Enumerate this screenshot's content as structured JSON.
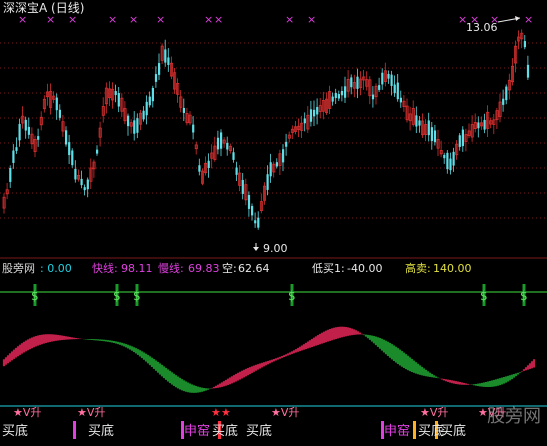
{
  "header": {
    "title": "深深宝A (日线)",
    "title_color": "#e8e8e8"
  },
  "price_panel": {
    "high_label": "13.06",
    "low_label": "9.00",
    "up_color": "#d93030",
    "down_color": "#5fe0e8",
    "signal_mark": "×",
    "signal_color": "#e040e0"
  },
  "indicators": {
    "name_label": "股旁网",
    "name_value": ": 0.00",
    "fast_label": "快线:",
    "fast_value": "98.11",
    "slow_label": "慢线:",
    "slow_value": "69.83",
    "kong_label": "空:",
    "kong_value": "62.64",
    "low_buy_label": "低买1:",
    "low_buy_value": "-40.00",
    "high_sell_label": "高卖:",
    "high_sell_value": "140.00",
    "colors": {
      "name": "#d8d8d8",
      "fast": "#e040e0",
      "slow": "#e040e0",
      "kong": "#e8e8e8",
      "low_buy": "#e8e8e8",
      "high_sell": "#e0e040"
    }
  },
  "signal_strip": {
    "line_color": "#40e040",
    "marker": "$"
  },
  "oscillator": {
    "bull_color": "#c0204a",
    "bear_color": "#1a8a2a",
    "line_color": "#20d0e0"
  },
  "annotations": {
    "v_up": "★V升",
    "buy_bottom": "买底",
    "jiaoshu": "申窑",
    "star": "★"
  },
  "watermark": "股旁网"
}
